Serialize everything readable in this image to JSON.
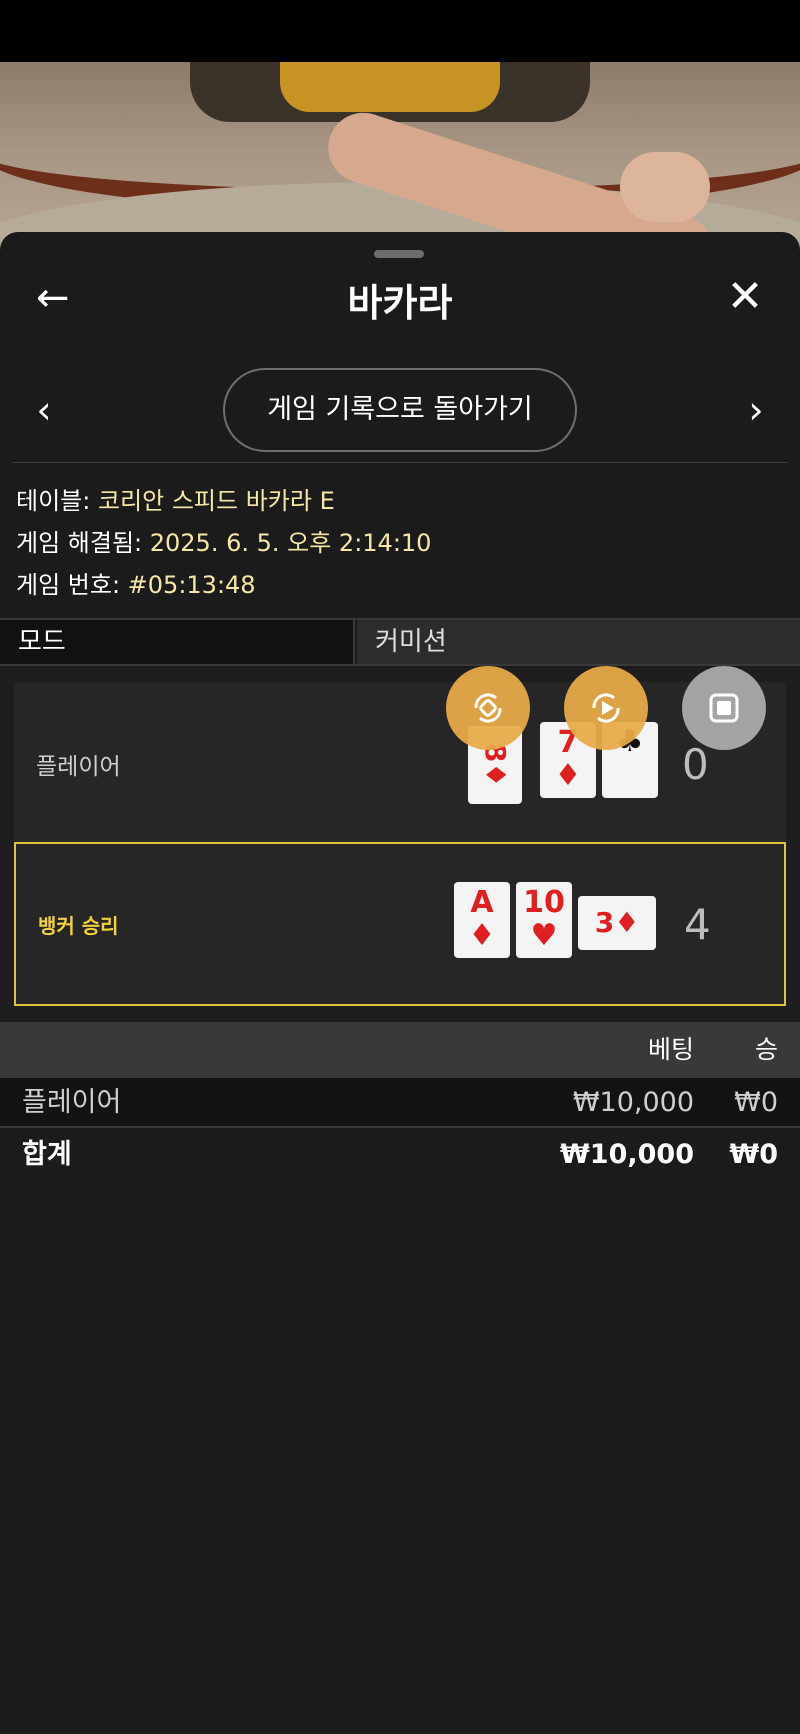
{
  "header": {
    "title": "바카라",
    "back_icon": "←",
    "close_icon": "✕"
  },
  "nav": {
    "prev_icon": "‹",
    "next_icon": "›",
    "history_label": "게임 기록으로 돌아가기"
  },
  "info": {
    "table_label": "테이블: ",
    "table_value": "코리안 스피드 바카라 E",
    "resolved_label": "게임 해결됨: ",
    "resolved_value": "2025. 6. 5. 오후 2:14:10",
    "game_no_label": "게임 번호: ",
    "game_no_value": "#05:13:48"
  },
  "mode": {
    "mode_label": "모드",
    "commission_label": "커미션"
  },
  "hands": {
    "player": {
      "label": "플레이어",
      "score": "0",
      "cards": [
        {
          "rank": "8",
          "suit": "♦",
          "color": "#e02020"
        },
        {
          "rank": "7",
          "suit": "♦",
          "color": "#e02020"
        },
        {
          "rank": "",
          "suit": "♣",
          "color": "#111111"
        }
      ]
    },
    "banker": {
      "label": "뱅커 승리",
      "score": "4",
      "cards": [
        {
          "rank": "A",
          "suit": "♦",
          "color": "#e02020"
        },
        {
          "rank": "10",
          "suit": "♥",
          "color": "#e02020"
        },
        {
          "rank": "3",
          "suit": "♦",
          "color": "#e02020"
        }
      ]
    }
  },
  "bets": {
    "header_bet": "베팅",
    "header_win": "승",
    "rows": [
      {
        "name": "플레이어",
        "bet": "₩10,000",
        "win": "₩0"
      }
    ],
    "total": {
      "name": "합계",
      "bet": "₩10,000",
      "win": "₩0"
    }
  },
  "floating_controls": {
    "icons": [
      "rotate-icon",
      "replay-icon",
      "stop-icon"
    ],
    "accent": "#e8aa48"
  },
  "colors": {
    "highlight": "#e3c23a",
    "info_value": "#f6e7a8",
    "suit_red": "#e02020"
  }
}
